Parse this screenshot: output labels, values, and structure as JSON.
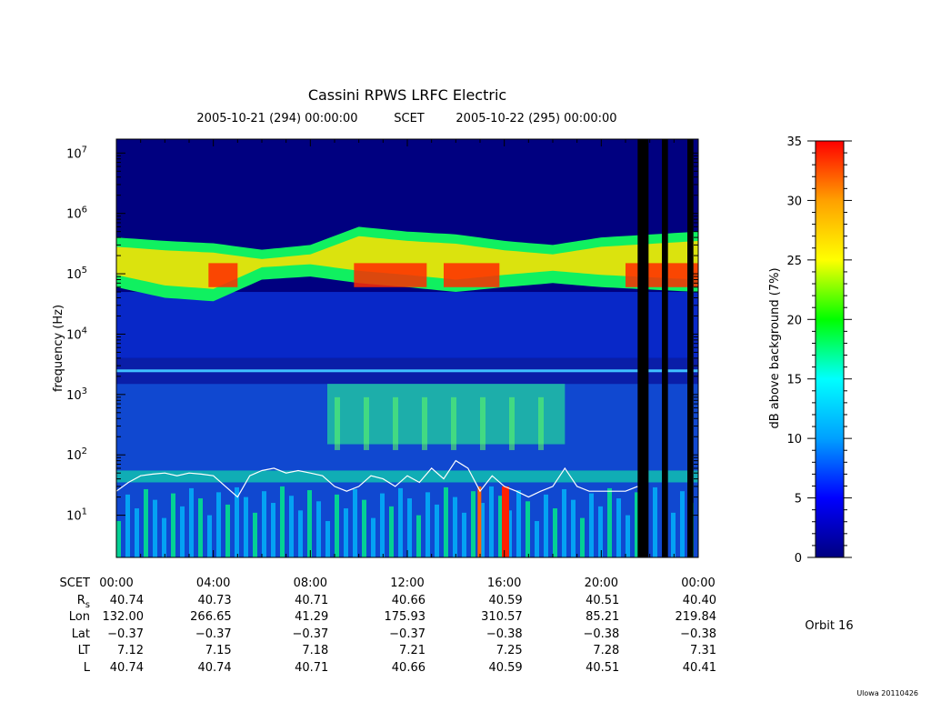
{
  "chart_data": {
    "type": "heatmap",
    "title": "Cassini RPWS LRFC Electric",
    "time_header": {
      "left": "2005-10-21 (294) 00:00:00",
      "middle": "SCET",
      "right": "2005-10-22 (295) 00:00:00"
    },
    "ylabel": "frequency (Hz)",
    "y_scale": "log",
    "ylim_hz": [
      2,
      17000000
    ],
    "y_ticks": [
      {
        "base": "10",
        "exp": "1",
        "value": 10
      },
      {
        "base": "10",
        "exp": "2",
        "value": 100
      },
      {
        "base": "10",
        "exp": "3",
        "value": 1000
      },
      {
        "base": "10",
        "exp": "4",
        "value": 10000
      },
      {
        "base": "10",
        "exp": "5",
        "value": 100000
      },
      {
        "base": "10",
        "exp": "6",
        "value": 1000000
      },
      {
        "base": "10",
        "exp": "7",
        "value": 10000000
      }
    ],
    "xlim_hours": [
      0,
      24
    ],
    "colorbar": {
      "label": "dB above background (7%)",
      "range": [
        0,
        35
      ],
      "ticks": [
        "0",
        "5",
        "10",
        "15",
        "20",
        "25",
        "30",
        "35"
      ],
      "colors": [
        "#000080",
        "#0000ff",
        "#00a0ff",
        "#00ffff",
        "#00ff00",
        "#ffff00",
        "#ffa000",
        "#ff0000"
      ]
    },
    "ephemeris": {
      "row_labels": [
        {
          "main": "SCET",
          "sub": ""
        },
        {
          "main": "R",
          "sub": "s"
        },
        {
          "main": "Lon",
          "sub": ""
        },
        {
          "main": "Lat",
          "sub": ""
        },
        {
          "main": "LT",
          "sub": ""
        },
        {
          "main": "L",
          "sub": ""
        }
      ],
      "columns": [
        [
          "00:00",
          "40.74",
          "132.00",
          "−0.37",
          "7.12",
          "40.74"
        ],
        [
          "04:00",
          "40.73",
          "266.65",
          "−0.37",
          "7.15",
          "40.74"
        ],
        [
          "08:00",
          "40.71",
          "41.29",
          "−0.37",
          "7.18",
          "40.71"
        ],
        [
          "12:00",
          "40.66",
          "175.93",
          "−0.37",
          "7.21",
          "40.66"
        ],
        [
          "16:00",
          "40.59",
          "310.57",
          "−0.38",
          "7.25",
          "40.59"
        ],
        [
          "20:00",
          "40.51",
          "85.21",
          "−0.38",
          "7.28",
          "40.51"
        ],
        [
          "00:00",
          "40.40",
          "219.84",
          "−0.38",
          "7.31",
          "40.41"
        ]
      ]
    },
    "emission_band": {
      "description_hours": [
        0,
        24
      ],
      "lower_edge_hz": [
        [
          0,
          60000
        ],
        [
          2,
          40000
        ],
        [
          4,
          35000
        ],
        [
          6,
          80000
        ],
        [
          8,
          90000
        ],
        [
          10,
          70000
        ],
        [
          12,
          60000
        ],
        [
          14,
          50000
        ],
        [
          16,
          60000
        ],
        [
          18,
          70000
        ],
        [
          20,
          60000
        ],
        [
          24,
          50000
        ]
      ],
      "upper_edge_hz": [
        [
          0,
          400000
        ],
        [
          2,
          350000
        ],
        [
          4,
          320000
        ],
        [
          6,
          250000
        ],
        [
          8,
          300000
        ],
        [
          10,
          600000
        ],
        [
          12,
          500000
        ],
        [
          14,
          450000
        ],
        [
          16,
          350000
        ],
        [
          18,
          300000
        ],
        [
          20,
          400000
        ],
        [
          24,
          500000
        ]
      ]
    },
    "data_gaps_hours": [
      [
        21.5,
        21.95
      ],
      [
        22.5,
        22.75
      ],
      [
        23.55,
        23.8
      ]
    ],
    "white_trace_series": {
      "x_hours": [
        0,
        0.5,
        1,
        1.5,
        2,
        2.5,
        3,
        3.5,
        4,
        4.5,
        5,
        5.5,
        6,
        6.5,
        7,
        7.5,
        8,
        8.5,
        9,
        9.5,
        10,
        10.5,
        11,
        11.5,
        12,
        12.5,
        13,
        13.5,
        14,
        14.5,
        15,
        15.5,
        16,
        16.5,
        17,
        17.5,
        18,
        18.5,
        19,
        19.5,
        20,
        20.5,
        21,
        21.5
      ],
      "y_hz": [
        25,
        35,
        45,
        48,
        50,
        45,
        50,
        48,
        45,
        30,
        20,
        45,
        55,
        60,
        50,
        55,
        50,
        45,
        30,
        25,
        30,
        45,
        40,
        30,
        45,
        35,
        60,
        40,
        80,
        60,
        25,
        45,
        30,
        25,
        20,
        25,
        30,
        60,
        30,
        25,
        25,
        25,
        25,
        30
      ]
    },
    "annotations": {
      "orbit": "Orbit 16",
      "version": "Ulowa 20110426"
    }
  }
}
